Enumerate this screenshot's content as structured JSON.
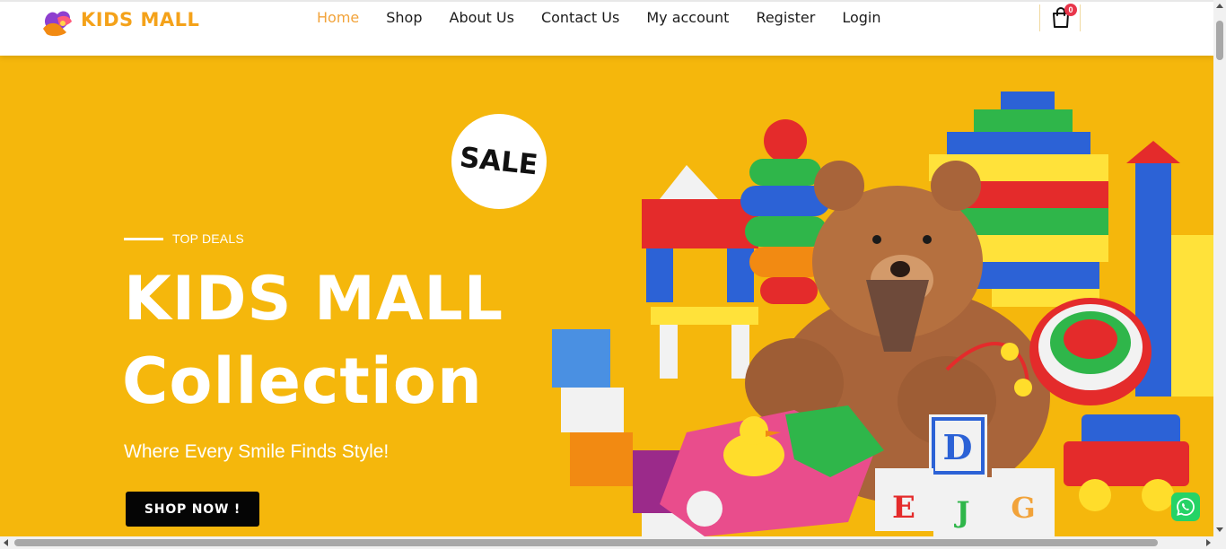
{
  "header": {
    "logo_text": "KIDS MALL",
    "nav": [
      {
        "label": "Home",
        "active": true
      },
      {
        "label": "Shop"
      },
      {
        "label": "About Us"
      },
      {
        "label": "Contact Us"
      },
      {
        "label": "My account"
      },
      {
        "label": "Register"
      },
      {
        "label": "Login"
      }
    ],
    "cart_count": "0"
  },
  "hero": {
    "badge": "SALE",
    "eyebrow": "TOP DEALS",
    "title_line1": "KIDS MALL",
    "title_line2": "Collection",
    "tagline": "Where Every Smile Finds Style!",
    "cta_label": "SHOP NOW !",
    "background_color": "#f5b70c"
  },
  "colors": {
    "accent": "#f2a33a",
    "button": "#050505",
    "cart_badge": "#e8364b",
    "whatsapp": "#25d366"
  },
  "icons": {
    "cart": "shopping-bag-icon",
    "chat": "whatsapp-icon"
  }
}
